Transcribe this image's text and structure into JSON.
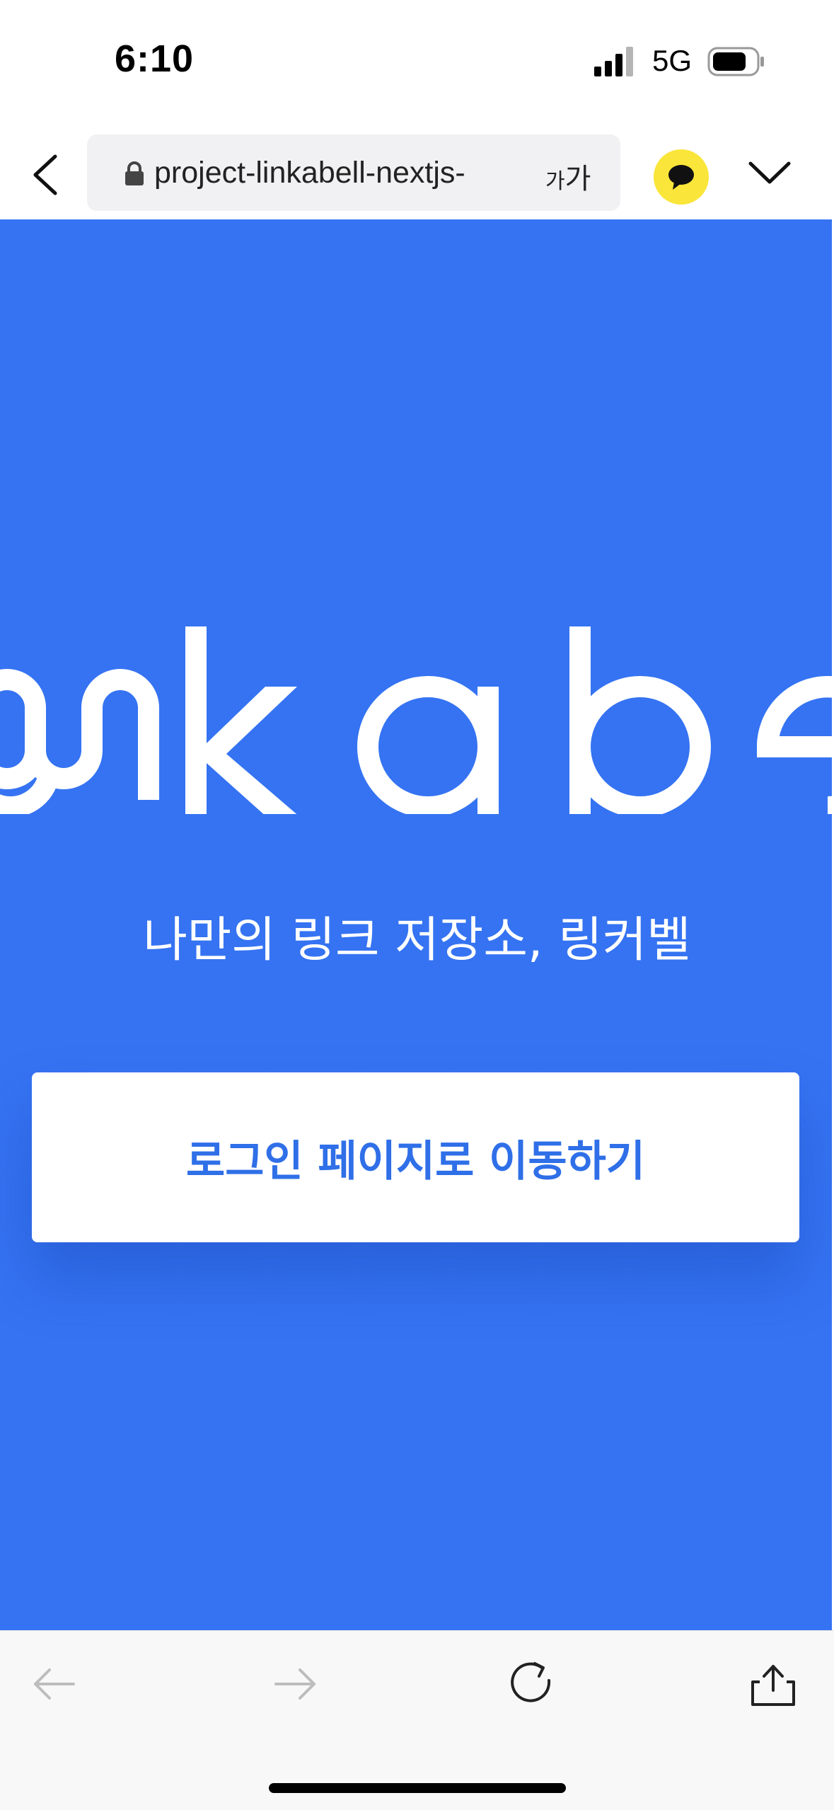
{
  "status_bar": {
    "time": "6:10",
    "network": "5G"
  },
  "browser": {
    "url": "project-linkabell-nextjs-",
    "text_size_small": "가",
    "text_size_large": "가"
  },
  "page": {
    "logo_text": "link a bell",
    "tagline": "나만의 링크 저장소, 링커벨",
    "login_button": "로그인 페이지로 이동하기",
    "background_color": "#3573f2"
  },
  "toolbar": {
    "icons": [
      "back-arrow-icon",
      "forward-arrow-icon",
      "reload-icon",
      "share-icon"
    ]
  }
}
